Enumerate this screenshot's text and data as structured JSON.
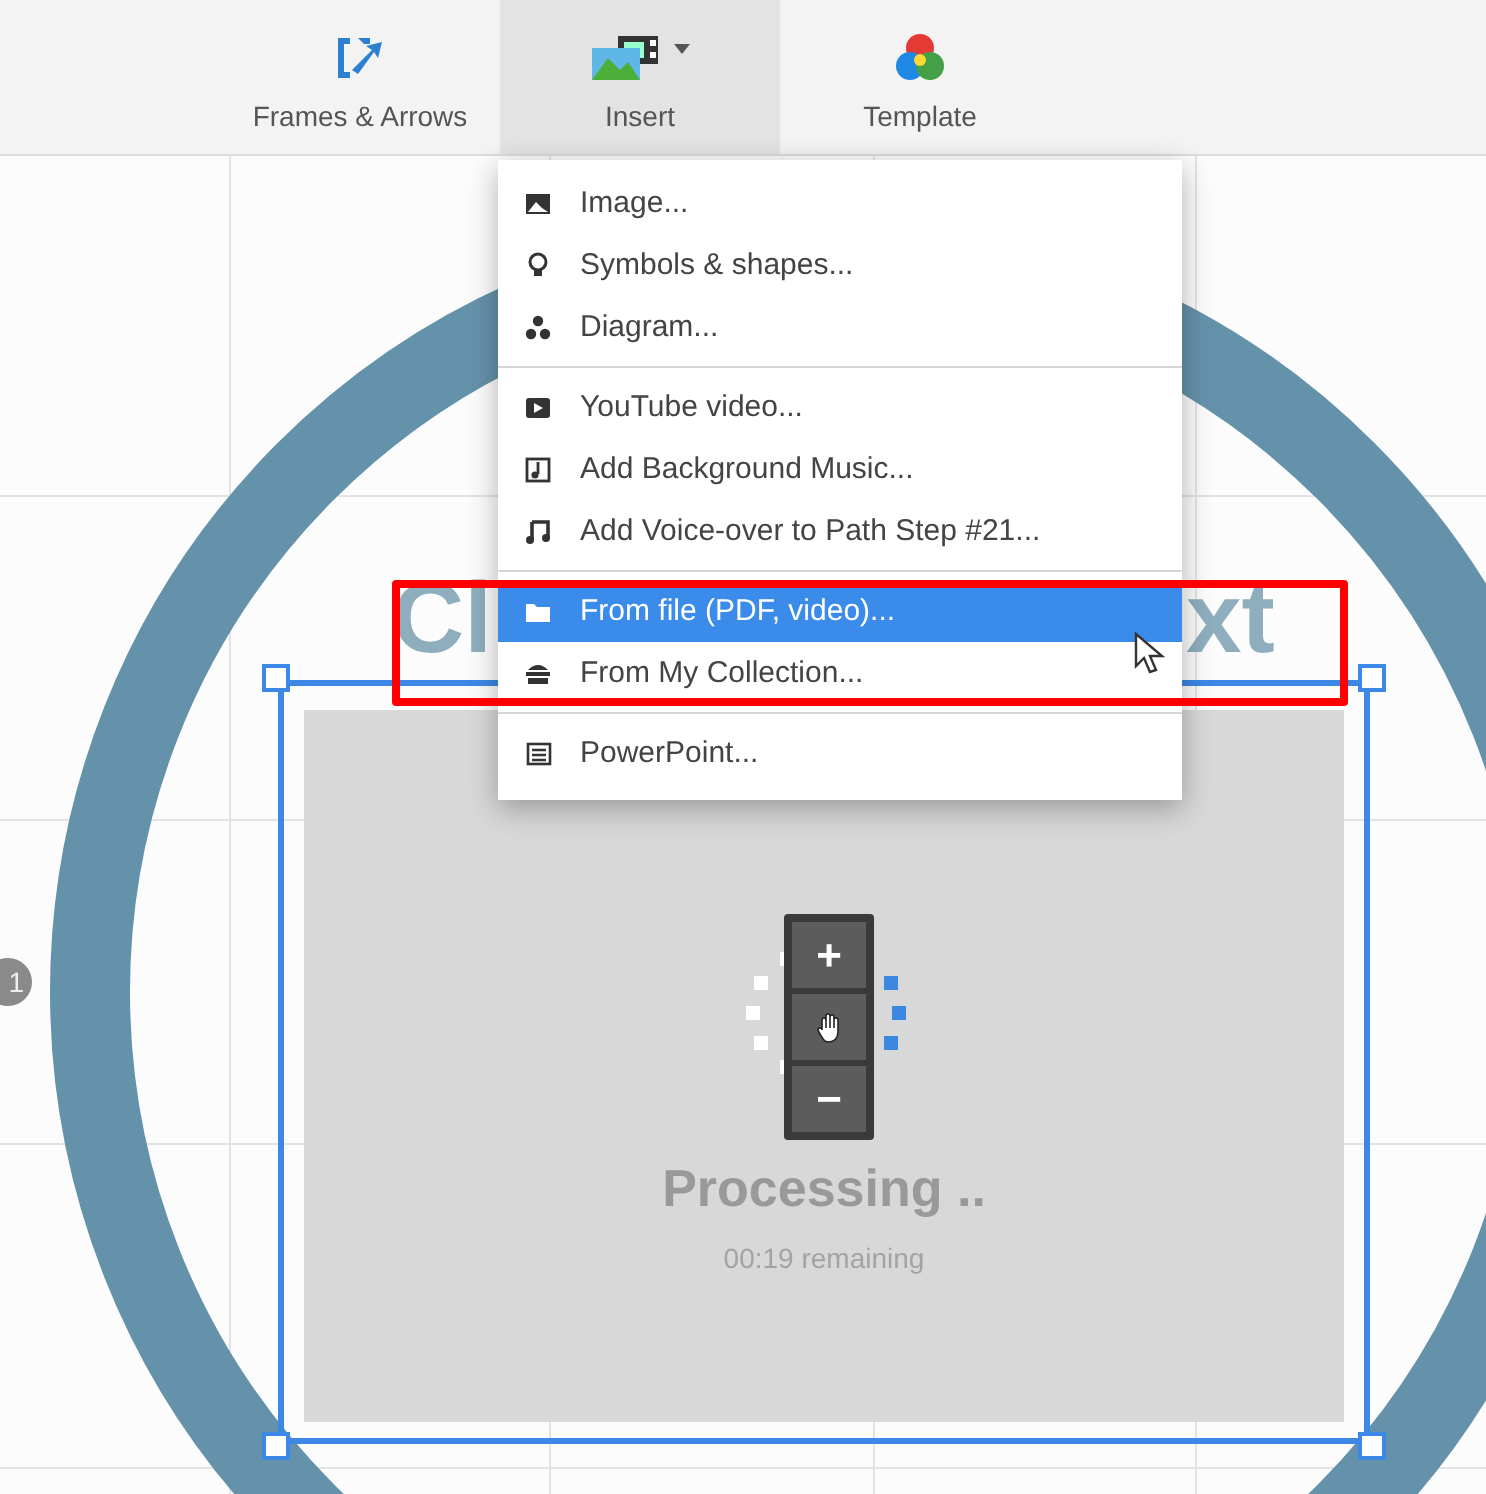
{
  "toolbar": {
    "items": [
      {
        "label": "Frames & Arrows",
        "kind": "frames",
        "selected": false
      },
      {
        "label": "Insert",
        "kind": "insert",
        "selected": true
      },
      {
        "label": "Template",
        "kind": "template",
        "selected": false
      }
    ]
  },
  "insert_menu": {
    "groups": [
      [
        {
          "label": "Image...",
          "kind": "image",
          "selected": false
        },
        {
          "label": "Symbols & shapes...",
          "kind": "bulb",
          "selected": false
        },
        {
          "label": "Diagram...",
          "kind": "diagram",
          "selected": false
        }
      ],
      [
        {
          "label": "YouTube video...",
          "kind": "play",
          "selected": false
        },
        {
          "label": "Add Background Music...",
          "kind": "musicfile",
          "selected": false
        },
        {
          "label": "Add Voice-over to Path Step #21...",
          "kind": "note",
          "selected": false
        }
      ],
      [
        {
          "label": "From file (PDF, video)...",
          "kind": "folder",
          "selected": true
        },
        {
          "label": "From My Collection...",
          "kind": "collection",
          "selected": false
        }
      ],
      [
        {
          "label": "PowerPoint...",
          "kind": "slides",
          "selected": false
        }
      ]
    ]
  },
  "canvas": {
    "heading_fragments": [
      "Cl",
      "xt"
    ],
    "step_badge": "1",
    "zoom_controls": [
      {
        "label": "+",
        "kind": "zoom-in"
      },
      {
        "kind": "pan"
      },
      {
        "label": "−",
        "kind": "zoom-out"
      }
    ],
    "processing": {
      "title": "Processing ..",
      "remaining": "00:19 remaining"
    }
  }
}
